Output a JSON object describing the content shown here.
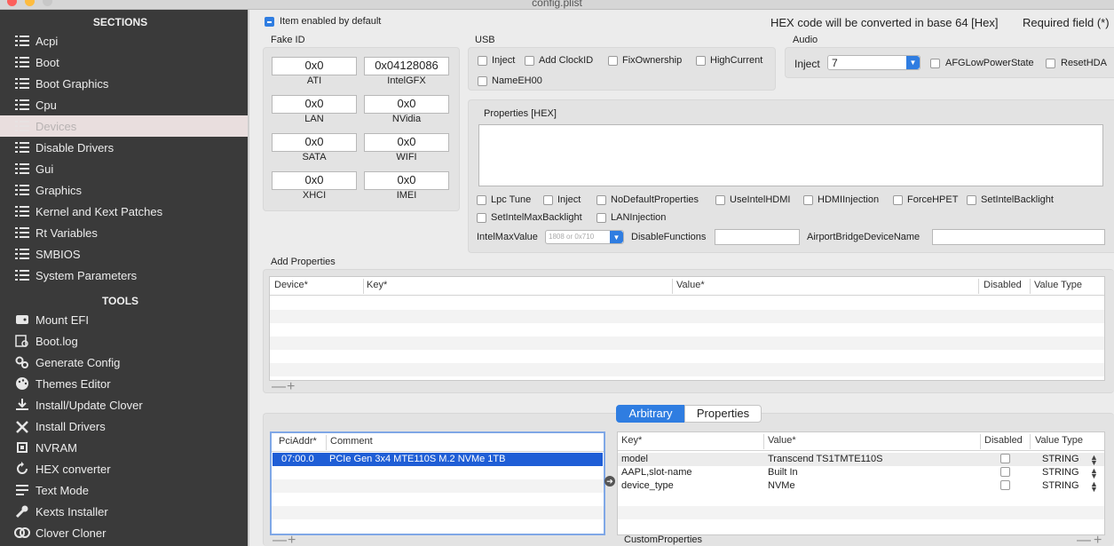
{
  "window": {
    "title": "config.plist"
  },
  "sidebar": {
    "sections_label": "SECTIONS",
    "tools_label": "TOOLS",
    "sections": [
      {
        "label": "Acpi",
        "icon": "list-icon"
      },
      {
        "label": "Boot",
        "icon": "list-icon"
      },
      {
        "label": "Boot Graphics",
        "icon": "list-icon"
      },
      {
        "label": "Cpu",
        "icon": "list-icon"
      },
      {
        "label": "Devices",
        "icon": "list-icon",
        "selected": true
      },
      {
        "label": "Disable Drivers",
        "icon": "list-icon"
      },
      {
        "label": "Gui",
        "icon": "list-icon"
      },
      {
        "label": "Graphics",
        "icon": "list-icon"
      },
      {
        "label": "Kernel and Kext Patches",
        "icon": "list-icon"
      },
      {
        "label": "Rt Variables",
        "icon": "list-icon"
      },
      {
        "label": "SMBIOS",
        "icon": "list-icon"
      },
      {
        "label": "System Parameters",
        "icon": "list-icon"
      }
    ],
    "tools": [
      {
        "label": "Mount EFI",
        "icon": "mount-icon"
      },
      {
        "label": "Boot.log",
        "icon": "log-icon"
      },
      {
        "label": "Generate Config",
        "icon": "gears-icon"
      },
      {
        "label": "Themes Editor",
        "icon": "palette-icon"
      },
      {
        "label": "Install/Update Clover",
        "icon": "download-icon"
      },
      {
        "label": "Install Drivers",
        "icon": "tools-icon"
      },
      {
        "label": "NVRAM",
        "icon": "chip-icon"
      },
      {
        "label": "HEX converter",
        "icon": "refresh-icon"
      },
      {
        "label": "Text Mode",
        "icon": "text-icon"
      },
      {
        "label": "Kexts Installer",
        "icon": "wrench-icon"
      },
      {
        "label": "Clover Cloner",
        "icon": "clone-icon"
      }
    ]
  },
  "header": {
    "item_enabled": "Item enabled by default",
    "hex_note": "HEX code will be converted in base 64 [Hex]",
    "required_note": "Required field (*)"
  },
  "fake_id": {
    "title": "Fake ID",
    "fields": [
      {
        "value": "0x0",
        "label": "ATI"
      },
      {
        "value": "0x04128086",
        "label": "IntelGFX"
      },
      {
        "value": "0x0",
        "label": "LAN"
      },
      {
        "value": "0x0",
        "label": "NVidia"
      },
      {
        "value": "0x0",
        "label": "SATA"
      },
      {
        "value": "0x0",
        "label": "WIFI"
      },
      {
        "value": "0x0",
        "label": "XHCI"
      },
      {
        "value": "0x0",
        "label": "IMEI"
      }
    ]
  },
  "usb": {
    "title": "USB",
    "options": [
      "Inject",
      "Add ClockID",
      "FixOwnership",
      "HighCurrent",
      "NameEH00"
    ]
  },
  "audio": {
    "title": "Audio",
    "inject_label": "Inject",
    "inject_value": "7",
    "options": [
      "AFGLowPowerState",
      "ResetHDA"
    ]
  },
  "properties": {
    "title": "Properties [HEX]",
    "options": [
      "Lpc Tune",
      "Inject",
      "NoDefaultProperties",
      "UseIntelHDMI",
      "HDMIInjection",
      "ForceHPET",
      "SetIntelBacklight",
      "SetIntelMaxBacklight",
      "LANInjection"
    ],
    "intel_max_label": "IntelMaxValue",
    "intel_max_placeholder": "1808 or 0x710",
    "disable_functions_label": "DisableFunctions",
    "airport_label": "AirportBridgeDeviceName"
  },
  "add_properties": {
    "title": "Add Properties",
    "columns": [
      "Device*",
      "Key*",
      "Value*",
      "Disabled",
      "Value Type"
    ]
  },
  "segmented": {
    "arbitrary": "Arbitrary",
    "properties": "Properties"
  },
  "arbitrary_table": {
    "columns": [
      "PciAddr*",
      "Comment"
    ],
    "rows": [
      {
        "addr": "07:00.0",
        "comment": "PCIe Gen 3x4 MTE110S M.2 NVMe 1TB"
      }
    ]
  },
  "key_table": {
    "columns": [
      "Key*",
      "Value*",
      "Disabled",
      "Value Type"
    ],
    "rows": [
      {
        "key": "model",
        "value": "Transcend TS1TMTE110S",
        "type": "STRING"
      },
      {
        "key": "AAPL,slot-name",
        "value": "Built In",
        "type": "STRING"
      },
      {
        "key": "device_type",
        "value": "NVMe",
        "type": "STRING"
      }
    ]
  },
  "custom_properties_label": "CustomProperties",
  "add_symbol": "+",
  "remove_symbol": "—",
  "colors": {
    "accent": "#2f7de1",
    "sidebar": "#3a3a3a",
    "selection": "#1f5ed6"
  }
}
